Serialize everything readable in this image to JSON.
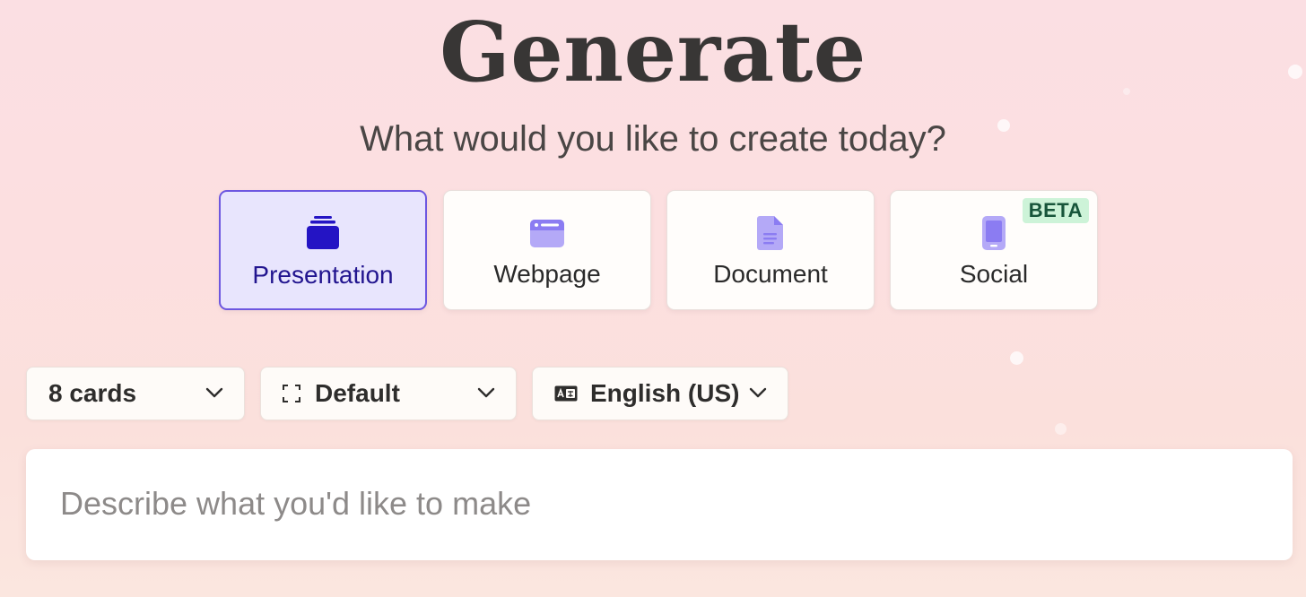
{
  "header": {
    "title": "Generate",
    "subtitle": "What would you like to create today?"
  },
  "types": [
    {
      "label": "Presentation",
      "icon": "stacked-cards-icon",
      "selected": true
    },
    {
      "label": "Webpage",
      "icon": "browser-window-icon",
      "selected": false
    },
    {
      "label": "Document",
      "icon": "document-icon",
      "selected": false
    },
    {
      "label": "Social",
      "icon": "phone-icon",
      "selected": false,
      "badge": "BETA"
    }
  ],
  "options": {
    "cards": {
      "value": "8 cards",
      "icon": "chevron-down-icon"
    },
    "format": {
      "value": "Default",
      "icon": "frame-brackets-icon"
    },
    "language": {
      "value": "English (US)",
      "icon": "language-icon"
    }
  },
  "prompt": {
    "placeholder": "Describe what you'd like to make",
    "value": ""
  },
  "colors": {
    "accent": "#6d57e0",
    "selected_bg": "#e8e5fd",
    "icon_purple": "#8b7cf2",
    "selected_icon": "#2414c4",
    "beta_bg": "#cdf3d8",
    "beta_text": "#17553a"
  }
}
